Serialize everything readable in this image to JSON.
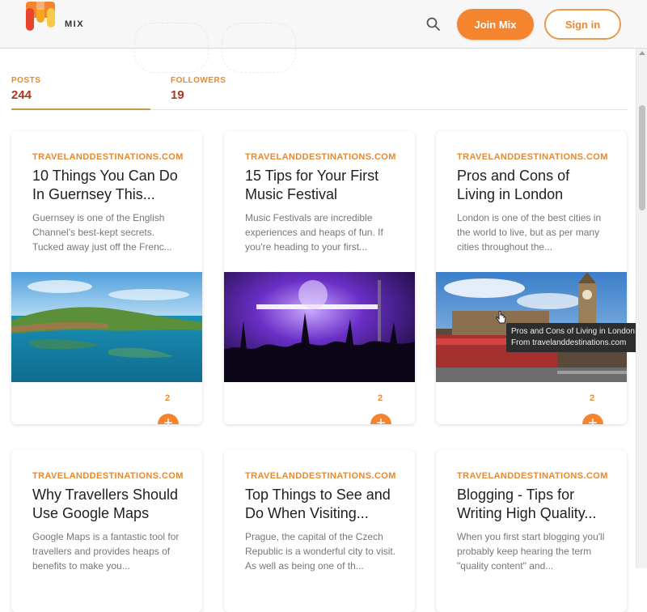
{
  "header": {
    "brand": "MIX",
    "join_label": "Join Mix",
    "signin_label": "Sign in",
    "search_icon": "search-icon",
    "colors": {
      "accent": "#f5842f",
      "accent_border": "#e89a4f"
    }
  },
  "stats": {
    "posts_label": "POSTS",
    "posts_value": "244",
    "followers_label": "FOLLOWERS",
    "followers_value": "19"
  },
  "cards": [
    {
      "domain": "TRAVELANDDESTINATIONS.COM",
      "title": "10 Things You Can Do In Guernsey This...",
      "desc": "Guernsey is one of the English Channel's best-kept secrets. Tucked away just off the Frenc...",
      "count": "2",
      "add": "+"
    },
    {
      "domain": "TRAVELANDDESTINATIONS.COM",
      "title": "15 Tips for Your First Music Festival",
      "desc": "Music Festivals are incredible experiences and heaps of fun. If you're heading to your first...",
      "count": "2",
      "add": "+"
    },
    {
      "domain": "TRAVELANDDESTINATIONS.COM",
      "title": "Pros and Cons of Living in London",
      "desc": "London is one of the best cities in the world to live, but as per many cities throughout the...",
      "count": "2",
      "add": "+"
    },
    {
      "domain": "TRAVELANDDESTINATIONS.COM",
      "title": "Why Travellers Should Use Google Maps",
      "desc": "Google Maps is a fantastic tool for travellers and provides heaps of benefits to make you..."
    },
    {
      "domain": "TRAVELANDDESTINATIONS.COM",
      "title": "Top Things to See and Do When Visiting...",
      "desc": "Prague, the capital of the Czech Republic is a wonderful city to visit. As well as being one of th..."
    },
    {
      "domain": "TRAVELANDDESTINATIONS.COM",
      "title": "Blogging - Tips for Writing High Quality...",
      "desc": "When you first start blogging you'll probably keep hearing the term \"quality content\" and..."
    }
  ],
  "tooltip": {
    "line1": "Pros and Cons of Living in London",
    "line2": "From travelanddestinations.com"
  }
}
